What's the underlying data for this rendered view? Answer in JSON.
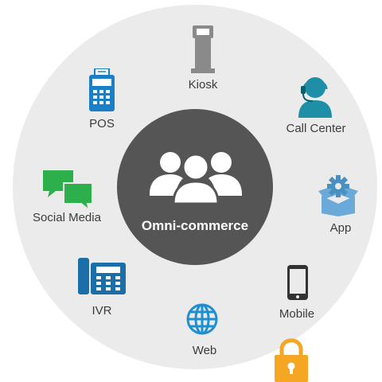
{
  "hub": {
    "label": "Omni-commerce",
    "icon": "users-group-icon"
  },
  "channels": [
    {
      "label": "Kiosk",
      "icon": "kiosk-icon"
    },
    {
      "label": "Call Center",
      "icon": "headset-agent-icon"
    },
    {
      "label": "App",
      "icon": "app-box-gear-icon"
    },
    {
      "label": "Mobile",
      "icon": "mobile-phone-icon"
    },
    {
      "label": "Web",
      "icon": "globe-icon"
    },
    {
      "label": "IVR",
      "icon": "desk-phone-icon"
    },
    {
      "label": "Social Media",
      "icon": "chat-bubbles-icon"
    },
    {
      "label": "POS",
      "icon": "pos-terminal-icon"
    }
  ],
  "extras": {
    "lock_icon": "padlock-icon"
  },
  "colors": {
    "outer_ring": "#ebebeb",
    "hub": "#555555",
    "kiosk": "#888888",
    "call_center": "#1e8fa6",
    "app": "#6aa9d8",
    "mobile": "#333333",
    "web": "#1e8fd0",
    "ivr": "#1a6fa8",
    "social_media": "#2db04b",
    "pos": "#1a7fc6",
    "lock": "#f5a623"
  }
}
